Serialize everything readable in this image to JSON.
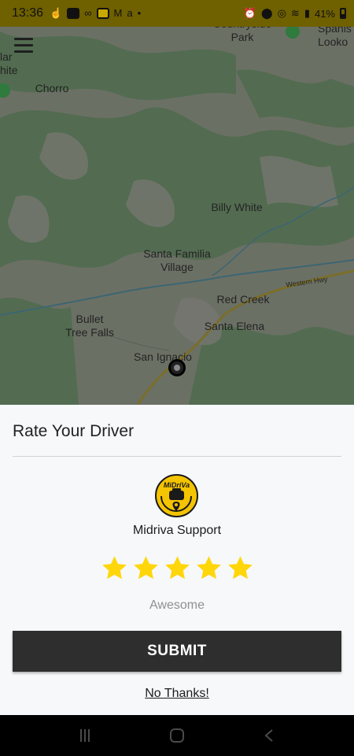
{
  "status_bar": {
    "time": "13:36",
    "battery": "41%"
  },
  "map": {
    "labels": {
      "countryside_park": "Countryside\nPark",
      "spanish_lookout": "Spanis\nLooko",
      "solar_white": "lar\nhite",
      "chorro": "Chorro",
      "billy_white": "Billy White",
      "santa_familia": "Santa Familia\nVillage",
      "western_hwy": "Western Hwy",
      "red_creek": "Red Creek",
      "bullet_tree": "Bullet\nTree Falls",
      "santa_elena": "Santa Elena",
      "san_ignacio": "San Ignacio"
    }
  },
  "sheet": {
    "title": "Rate Your Driver",
    "logo_text": "MiDriVa",
    "support_name": "Midriva Support",
    "rating": 5,
    "max_rating": 5,
    "rating_text": "Awesome",
    "submit_label": "SUBMIT",
    "no_thanks_label": "No Thanks!"
  },
  "colors": {
    "star": "#ffd60a",
    "submit_bg": "#2e2e2e",
    "status_bar_bg": "#6f6000"
  }
}
